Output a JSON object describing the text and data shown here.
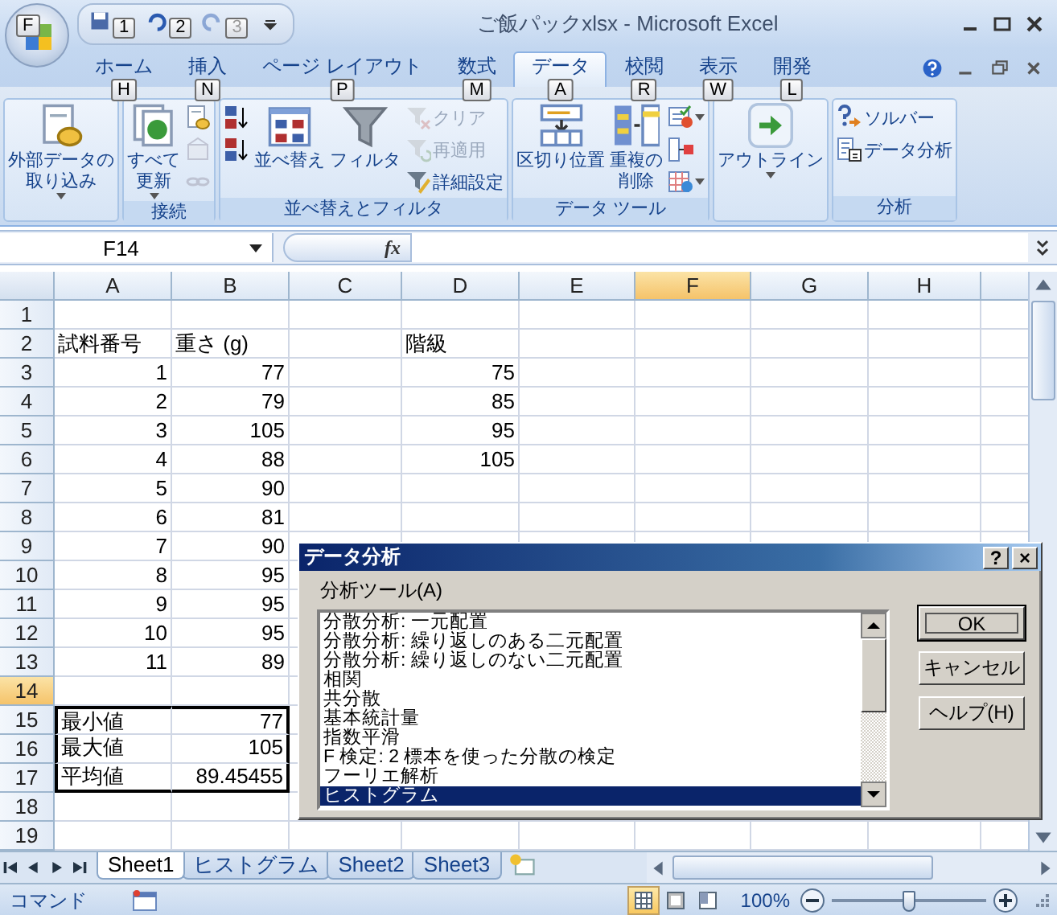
{
  "window": {
    "title": "ご飯パックxlsx - Microsoft Excel"
  },
  "office_button": {
    "keytip": "F"
  },
  "quick_access": [
    {
      "keytip": "1",
      "disabled": false
    },
    {
      "keytip": "2",
      "disabled": false
    },
    {
      "keytip": "3",
      "disabled": true
    }
  ],
  "tabs": [
    {
      "label": "ホーム",
      "keytip": "H",
      "selected": false
    },
    {
      "label": "挿入",
      "keytip": "N",
      "selected": false
    },
    {
      "label": "ページ レイアウト",
      "keytip": "P",
      "selected": false
    },
    {
      "label": "数式",
      "keytip": "M",
      "selected": false
    },
    {
      "label": "データ",
      "keytip": "A",
      "selected": true
    },
    {
      "label": "校閲",
      "keytip": "R",
      "selected": false
    },
    {
      "label": "表示",
      "keytip": "W",
      "selected": false
    },
    {
      "label": "開発",
      "keytip": "L",
      "selected": false
    }
  ],
  "ribbon_groups": [
    {
      "columns": [
        [
          {
            "kind": "large",
            "lines": [
              "外部データの",
              "取り込み"
            ],
            "dropdown": true,
            "disabled": false
          }
        ]
      ]
    },
    {
      "label": "接続",
      "columns": [
        [
          {
            "kind": "large",
            "lines": [
              "すべて",
              "更新"
            ],
            "dropdown": true,
            "disabled": false
          }
        ],
        [
          {
            "kind": "icon",
            "dropdown": false,
            "disabled": false
          },
          {
            "kind": "icon",
            "dropdown": false,
            "disabled": true
          },
          {
            "kind": "icon",
            "dropdown": false,
            "disabled": true
          }
        ]
      ]
    },
    {
      "label": "並べ替えとフィルタ",
      "columns": [
        [
          {
            "kind": "icon",
            "dropdown": false,
            "disabled": false
          },
          {
            "kind": "icon",
            "dropdown": false,
            "disabled": false
          }
        ],
        [
          {
            "kind": "large",
            "lines": [
              "並べ替え"
            ],
            "dropdown": false,
            "disabled": false
          }
        ],
        [
          {
            "kind": "large",
            "lines": [
              "フィルタ"
            ],
            "dropdown": false,
            "disabled": false
          }
        ],
        [
          {
            "kind": "small",
            "label": "クリア",
            "dropdown": false,
            "disabled": true
          },
          {
            "kind": "small",
            "label": "再適用",
            "dropdown": false,
            "disabled": true
          },
          {
            "kind": "small",
            "label": "詳細設定",
            "dropdown": false,
            "disabled": false
          }
        ]
      ]
    },
    {
      "label": "データ ツール",
      "columns": [
        [
          {
            "kind": "large",
            "lines": [
              "区切り位置"
            ],
            "dropdown": false,
            "disabled": false
          }
        ],
        [
          {
            "kind": "large",
            "lines": [
              "重複の",
              "削除"
            ],
            "dropdown": false,
            "disabled": false
          }
        ],
        [
          {
            "kind": "icon",
            "dropdown": true,
            "disabled": false
          },
          {
            "kind": "icon",
            "dropdown": false,
            "disabled": false
          },
          {
            "kind": "icon",
            "dropdown": true,
            "disabled": false
          }
        ]
      ]
    },
    {
      "columns": [
        [
          {
            "kind": "large",
            "lines": [
              "アウトライン"
            ],
            "dropdown": true,
            "disabled": false
          }
        ]
      ]
    },
    {
      "label": "分析",
      "columns": [
        [
          {
            "kind": "small",
            "label": "ソルバー",
            "dropdown": false,
            "disabled": false
          },
          {
            "kind": "small",
            "label": "データ分析",
            "dropdown": false,
            "disabled": false
          }
        ]
      ]
    }
  ],
  "formula_bar": {
    "name_box": "F14",
    "function_label": "fx"
  },
  "columns": [
    {
      "label": "A",
      "selected": false
    },
    {
      "label": "B",
      "selected": false
    },
    {
      "label": "C",
      "selected": false
    },
    {
      "label": "D",
      "selected": false
    },
    {
      "label": "E",
      "selected": false
    },
    {
      "label": "F",
      "selected": true
    },
    {
      "label": "G",
      "selected": false
    },
    {
      "label": "H",
      "selected": false
    }
  ],
  "rows": [
    {
      "number": "1",
      "selected": false,
      "kind": "blank"
    },
    {
      "number": "2",
      "selected": false,
      "kind": "header",
      "cells": [
        "試料番号",
        "重さ (g)",
        null,
        "階級"
      ]
    },
    {
      "number": "3",
      "selected": false,
      "kind": "data",
      "cells": [
        "1",
        "77",
        null,
        "75"
      ]
    },
    {
      "number": "4",
      "selected": false,
      "kind": "data",
      "cells": [
        "2",
        "79",
        null,
        "85"
      ]
    },
    {
      "number": "5",
      "selected": false,
      "kind": "data",
      "cells": [
        "3",
        "105",
        null,
        "95"
      ]
    },
    {
      "number": "6",
      "selected": false,
      "kind": "data",
      "cells": [
        "4",
        "88",
        null,
        "105"
      ]
    },
    {
      "number": "7",
      "selected": false,
      "kind": "data",
      "cells": [
        "5",
        "90"
      ]
    },
    {
      "number": "8",
      "selected": false,
      "kind": "data",
      "cells": [
        "6",
        "81"
      ]
    },
    {
      "number": "9",
      "selected": false,
      "kind": "data",
      "cells": [
        "7",
        "90"
      ]
    },
    {
      "number": "10",
      "selected": false,
      "kind": "data",
      "cells": [
        "8",
        "95"
      ]
    },
    {
      "number": "11",
      "selected": false,
      "kind": "data",
      "cells": [
        "9",
        "95"
      ]
    },
    {
      "number": "12",
      "selected": false,
      "kind": "data",
      "cells": [
        "10",
        "95"
      ]
    },
    {
      "number": "13",
      "selected": false,
      "kind": "data",
      "cells": [
        "11",
        "89"
      ]
    },
    {
      "number": "14",
      "selected": true,
      "kind": "blank"
    },
    {
      "number": "15",
      "selected": false,
      "kind": "summary",
      "cells": [
        "最小値",
        "77"
      ]
    },
    {
      "number": "16",
      "selected": false,
      "kind": "summary",
      "cells": [
        "最大値",
        "105"
      ]
    },
    {
      "number": "17",
      "selected": false,
      "kind": "summary",
      "cells": [
        "平均値",
        "89.45455"
      ]
    },
    {
      "number": "18",
      "selected": false,
      "kind": "blank"
    },
    {
      "number": "19",
      "selected": false,
      "kind": "blank"
    }
  ],
  "sheet_tabs": [
    {
      "label": "Sheet1",
      "selected": true
    },
    {
      "label": "ヒストグラム",
      "selected": false
    },
    {
      "label": "Sheet2",
      "selected": false
    },
    {
      "label": "Sheet3",
      "selected": false
    }
  ],
  "status_bar": {
    "mode": "コマンド",
    "views": [
      {
        "selected": true
      },
      {
        "selected": false
      },
      {
        "selected": false
      }
    ],
    "zoom": "100%",
    "zoom_slider": {
      "level": 0.5
    }
  },
  "dialog": {
    "title": "データ分析",
    "help_button": "?",
    "close_button": "×",
    "list_label": "分析ツール(A)",
    "tools": [
      {
        "label": "分散分析: 一元配置",
        "selected": false
      },
      {
        "label": "分散分析: 繰り返しのある二元配置",
        "selected": false
      },
      {
        "label": "分散分析: 繰り返しのない二元配置",
        "selected": false
      },
      {
        "label": "相関",
        "selected": false
      },
      {
        "label": "共分散",
        "selected": false
      },
      {
        "label": "基本統計量",
        "selected": false
      },
      {
        "label": "指数平滑",
        "selected": false
      },
      {
        "label": "F 検定: 2 標本を使った分散の検定",
        "selected": false
      },
      {
        "label": "フーリエ解析",
        "selected": false
      },
      {
        "label": "ヒストグラム",
        "selected": true
      }
    ],
    "buttons": [
      {
        "label": "OK",
        "default": true
      },
      {
        "label": "キャンセル",
        "default": false
      },
      {
        "label": "ヘルプ(H)",
        "default": false
      }
    ]
  }
}
